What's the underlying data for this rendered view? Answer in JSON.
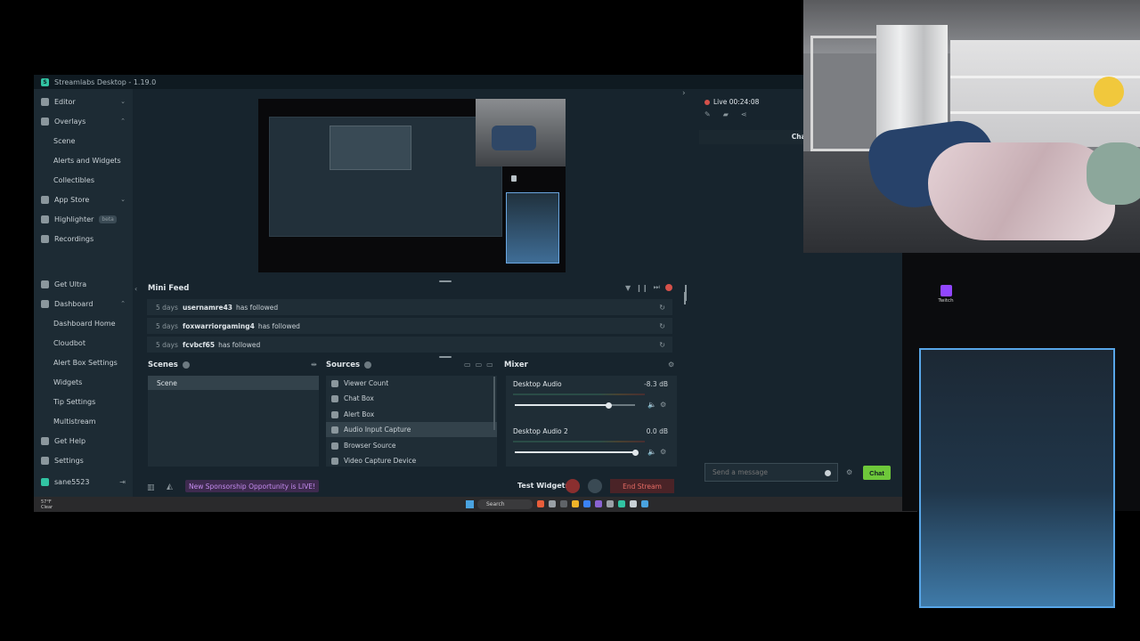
{
  "window": {
    "title": "Streamlabs Desktop - 1.19.0",
    "logo_letter": "S"
  },
  "sidebar": {
    "items": [
      {
        "label": "Editor",
        "icon": "editor-icon",
        "chev": "⌄"
      },
      {
        "label": "Overlays",
        "icon": "overlays-icon",
        "chev": "⌃"
      },
      {
        "label": "Scene",
        "sub": true
      },
      {
        "label": "Alerts and Widgets",
        "sub": true
      },
      {
        "label": "Collectibles",
        "sub": true
      },
      {
        "label": "App Store",
        "icon": "app-store-icon",
        "chev": "⌄"
      },
      {
        "label": "Highlighter",
        "icon": "highlighter-icon",
        "badge": "beta"
      },
      {
        "label": "Recordings",
        "icon": "recordings-icon"
      },
      {
        "label": "Get Ultra",
        "icon": "ultra-icon"
      },
      {
        "label": "Dashboard",
        "icon": "dashboard-icon",
        "chev": "⌃"
      },
      {
        "label": "Dashboard Home",
        "sub": true
      },
      {
        "label": "Cloudbot",
        "sub": true
      },
      {
        "label": "Alert Box Settings",
        "sub": true
      },
      {
        "label": "Widgets",
        "sub": true
      },
      {
        "label": "Tip Settings",
        "sub": true
      },
      {
        "label": "Multistream",
        "sub": true
      },
      {
        "label": "Get Help",
        "icon": "help-icon"
      },
      {
        "label": "Settings",
        "icon": "settings-icon"
      }
    ],
    "user": {
      "name": "sane5523",
      "logout": "⇥"
    }
  },
  "minifeed": {
    "title": "Mini Feed",
    "collapse": "‹",
    "tools": {
      "filter": "▼",
      "pause": "❙❙",
      "skip": "⏭"
    },
    "rows": [
      {
        "when": "5 days",
        "who": "usernamre43",
        "what": "has followed",
        "replay": "↻"
      },
      {
        "when": "5 days",
        "who": "foxwarriorgaming4",
        "what": "has followed",
        "replay": "↻"
      },
      {
        "when": "5 days",
        "who": "fcvbcf65",
        "what": "has followed",
        "replay": "↻"
      }
    ]
  },
  "scenes": {
    "title": "Scenes",
    "tool": "⇹",
    "items": [
      "Scene"
    ]
  },
  "sources": {
    "title": "Sources",
    "tools": [
      "▭",
      "▭",
      "▭"
    ],
    "items": [
      {
        "label": "Viewer Count",
        "selected": false
      },
      {
        "label": "Chat Box",
        "selected": false
      },
      {
        "label": "Alert Box",
        "selected": false
      },
      {
        "label": "Audio Input Capture",
        "selected": true
      },
      {
        "label": "Browser Source",
        "selected": false
      },
      {
        "label": "Video Capture Device",
        "selected": false
      }
    ]
  },
  "mixer": {
    "title": "Mixer",
    "gear": "⚙",
    "channels": [
      {
        "name": "Desktop Audio",
        "db": "-8.3 dB",
        "level": 0.78,
        "mute": "🔈",
        "gear": "⚙"
      },
      {
        "name": "Desktop Audio 2",
        "db": "0.0 dB",
        "level": 1.0,
        "mute": "🔈",
        "gear": "⚙"
      }
    ]
  },
  "footer": {
    "stats": "▥",
    "ai": "◭",
    "sponsorship": "New Sponsorship Opportunity is LIVE!",
    "test_widgets": "Test Widgets",
    "end_stream": "End Stream"
  },
  "chat": {
    "live": "Live 00:24:08",
    "tools": [
      "✎",
      "▰",
      "⋖"
    ],
    "header": "Chat",
    "placeholder": "Send a message",
    "gear": "⚙",
    "send": "Chat"
  },
  "taskbar": {
    "search": "Search",
    "weather": "57°F Clear"
  },
  "desktop": {
    "twitch_label": "Twitch"
  },
  "colors": {
    "accent": "#31c3a2",
    "live": "#d5514a",
    "chat_button": "#6ec83a",
    "sponsor": "#c58cf0",
    "end_stream": "#e56b64"
  }
}
